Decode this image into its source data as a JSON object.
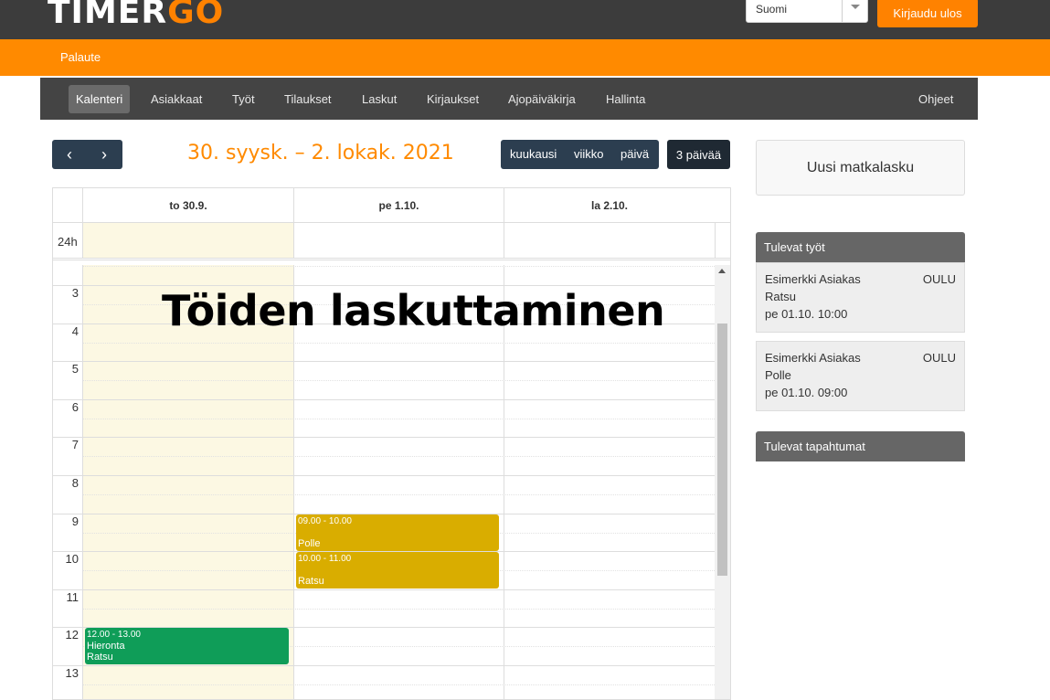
{
  "brand": {
    "part1": "TIMER",
    "part2": "GO",
    "accent": "#ff8200"
  },
  "header": {
    "language": "Suomi",
    "logout_label": "Kirjaudu ulos"
  },
  "subbar": {
    "feedback_label": "Palaute"
  },
  "nav": {
    "items": [
      "Kalenteri",
      "Asiakkaat",
      "Työt",
      "Tilaukset",
      "Laskut",
      "Kirjaukset",
      "Ajopäiväkirja",
      "Hallinta"
    ],
    "active": "Kalenteri",
    "help_label": "Ohjeet"
  },
  "toolbar": {
    "prev_icon": "chevron-left-icon",
    "next_icon": "chevron-right-icon",
    "prev_glyph": "‹",
    "next_glyph": "›",
    "range_title": "30. syysk. – 2. lokak. 2021",
    "views": [
      "kuukausi",
      "viikko",
      "päivä"
    ],
    "active_view": "3 päivää"
  },
  "calendar": {
    "columns": [
      "to 30.9.",
      "pe 1.10.",
      "la 2.10."
    ],
    "allday_label": "24h",
    "hours": [
      "3",
      "4",
      "5",
      "6",
      "7",
      "8",
      "9",
      "10",
      "11",
      "12",
      "13"
    ],
    "events": [
      {
        "day": 1,
        "start": 9,
        "end": 10,
        "time": "09.00 - 10.00",
        "title": "",
        "subtitle": "Polle",
        "color": "#d9ad00"
      },
      {
        "day": 1,
        "start": 10,
        "end": 11,
        "time": "10.00 - 11.00",
        "title": "",
        "subtitle": "Ratsu",
        "color": "#d9ad00"
      },
      {
        "day": 0,
        "start": 12,
        "end": 13,
        "time": "12.00 - 13.00",
        "title": "Hieronta",
        "subtitle": "Ratsu",
        "color": "#0f9d58"
      }
    ]
  },
  "overlay_caption": "Töiden laskuttaminen",
  "sidebar": {
    "new_button": "Uusi matkalasku",
    "upcoming_jobs_title": "Tulevat työt",
    "jobs": [
      {
        "customer": "Esimerkki Asiakas",
        "city": "OULU",
        "horse": "Ratsu",
        "when": "pe 01.10. 10:00"
      },
      {
        "customer": "Esimerkki Asiakas",
        "city": "OULU",
        "horse": "Polle",
        "when": "pe 01.10. 09:00"
      }
    ],
    "upcoming_events_title": "Tulevat tapahtumat"
  }
}
